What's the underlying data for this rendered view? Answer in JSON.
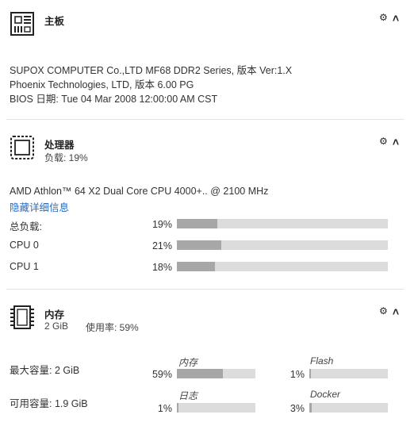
{
  "motherboard": {
    "title": "主板",
    "lines": [
      "SUPOX COMPUTER Co.,LTD MF68 DDR2 Series, 版本 Ver:1.X",
      "Phoenix Technologies, LTD, 版本 6.00 PG",
      "BIOS 日期: Tue 04 Mar 2008 12:00:00 AM CST"
    ],
    "icon": "motherboard-icon"
  },
  "processor": {
    "title": "处理器",
    "load_text": "负载: 19%",
    "model": "AMD Athlon™ 64 X2 Dual Core CPU 4000+.. @ 2100 MHz",
    "hide_details": "隐藏详细信息",
    "icon": "cpu-icon",
    "rows": [
      {
        "label": "总负载:",
        "pct_text": "19%",
        "value": 19
      },
      {
        "label": "CPU 0",
        "pct_text": "21%",
        "value": 21
      },
      {
        "label": "CPU 1",
        "pct_text": "18%",
        "value": 18
      }
    ]
  },
  "memory": {
    "title": "内存",
    "size": "2 GiB",
    "usage": "使用率: 59%",
    "icon": "memory-icon",
    "max_capacity": "最大容量: 2 GiB",
    "available": "可用容量: 1.9 GiB",
    "gauges": [
      {
        "name": "内存",
        "pct_text": "59%",
        "value": 59
      },
      {
        "name": "Flash",
        "pct_text": "1%",
        "value": 1
      },
      {
        "name": "日志",
        "pct_text": "1%",
        "value": 1
      },
      {
        "name": "Docker",
        "pct_text": "3%",
        "value": 3
      }
    ]
  },
  "controls": {
    "gear_icon": "gear-icon",
    "collapse_icon": "chevron-up-icon"
  },
  "colors": {
    "bar_track": "#dcdcdc",
    "bar_fill": "#a7a7a7",
    "link": "#2a6bc4"
  }
}
